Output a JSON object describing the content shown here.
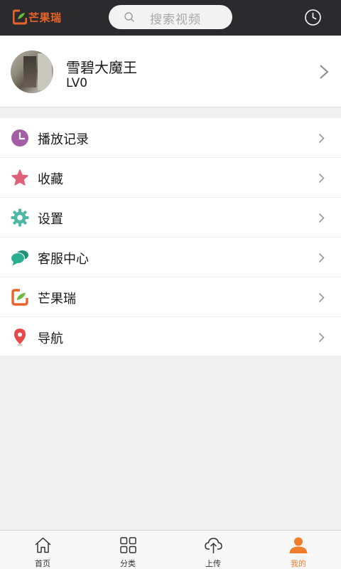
{
  "header": {
    "logo_text": "芒果瑞",
    "search_placeholder": "搜索视频"
  },
  "profile": {
    "username": "雪碧大魔王",
    "level": "LV0"
  },
  "menu": {
    "items": [
      {
        "label": "播放记录",
        "icon": "clock-icon",
        "color": "#a45ea6"
      },
      {
        "label": "收藏",
        "icon": "star-icon",
        "color": "#e0607a"
      },
      {
        "label": "设置",
        "icon": "gear-icon",
        "color": "#4fb7a5"
      },
      {
        "label": "客服中心",
        "icon": "chat-icon",
        "color": "#23a686"
      },
      {
        "label": "芒果瑞",
        "icon": "mango-logo-icon",
        "color": "#e8642a"
      },
      {
        "label": "导航",
        "icon": "location-pin-icon",
        "color": "#e84a4a"
      }
    ]
  },
  "bottom_nav": {
    "items": [
      {
        "label": "首页",
        "icon": "home-icon"
      },
      {
        "label": "分类",
        "icon": "grid-icon"
      },
      {
        "label": "上传",
        "icon": "upload-cloud-icon"
      },
      {
        "label": "我的",
        "icon": "user-icon",
        "active": true
      }
    ]
  },
  "colors": {
    "topbar": "#2b2b2d",
    "accent": "#f07d2c",
    "background": "#f0f0f0"
  }
}
